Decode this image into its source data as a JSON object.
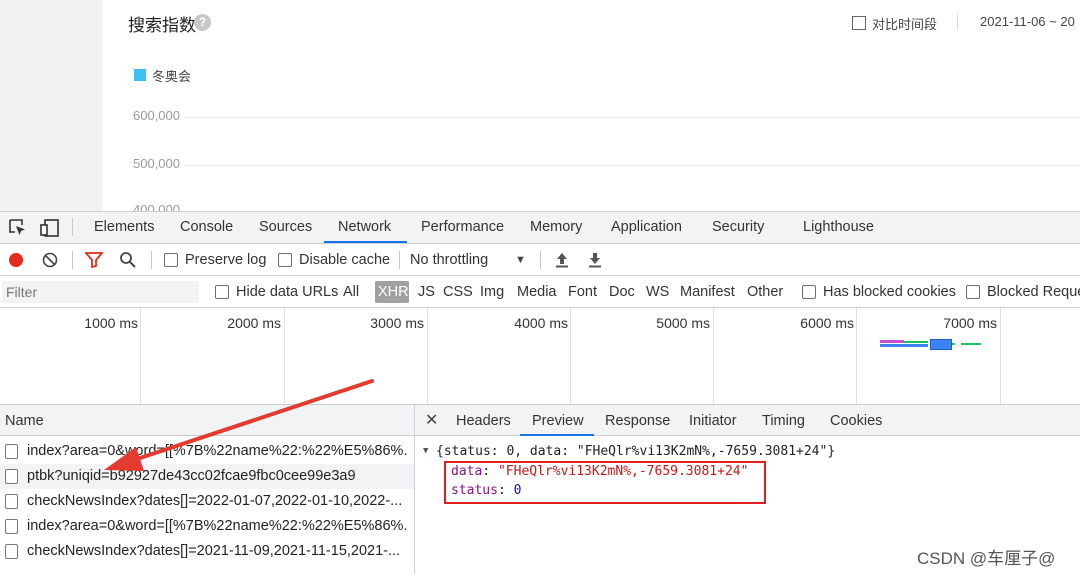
{
  "chart": {
    "title": "搜索指数",
    "help_icon": "?",
    "compare_label": "对比时间段",
    "date_range": "2021-11-06 ~ 20",
    "legend": "冬奥会",
    "legend_color": "#3ec1f0",
    "yticks": [
      "600,000",
      "500,000",
      "400,000"
    ]
  },
  "devtools": {
    "tabs": [
      "Elements",
      "Console",
      "Sources",
      "Network",
      "Performance",
      "Memory",
      "Application",
      "Security",
      "Lighthouse"
    ],
    "active_tab": "Network",
    "accent_color": "#1a73e8",
    "toolbar": {
      "preserve_log": "Preserve log",
      "disable_cache": "Disable cache",
      "throttling": "No throttling"
    },
    "filter": {
      "placeholder": "Filter",
      "hide_data_urls": "Hide data URLs",
      "types": [
        "All",
        "XHR",
        "JS",
        "CSS",
        "Img",
        "Media",
        "Font",
        "Doc",
        "WS",
        "Manifest",
        "Other"
      ],
      "active_type": "XHR",
      "has_blocked_cookies": "Has blocked cookies",
      "blocked_requests": "Blocked Reque"
    },
    "timeline": {
      "labels": [
        "1000 ms",
        "2000 ms",
        "3000 ms",
        "4000 ms",
        "5000 ms",
        "6000 ms",
        "7000 ms"
      ]
    },
    "requests": {
      "header": "Name",
      "rows": [
        "index?area=0&word=[[%7B%22name%22:%22%E5%86%...",
        "ptbk?uniqid=b92927de43cc02fcae9fbc0cee99e3a9",
        "checkNewsIndex?dates[]=2022-01-07,2022-01-10,2022-...",
        "index?area=0&word=[[%7B%22name%22:%22%E5%86%...",
        "checkNewsIndex?dates[]=2021-11-09,2021-11-15,2021-..."
      ],
      "selected_index": 1
    },
    "detail": {
      "tabs": [
        "Headers",
        "Preview",
        "Response",
        "Initiator",
        "Timing",
        "Cookies"
      ],
      "active_tab": "Preview",
      "summary": "{status: 0, data: \"FHeQlr%vi13K2mN%,-7659.3081+24\"}",
      "data_key": "data",
      "data_value": "\"FHeQlr%vi13K2mN%,-7659.3081+24\"",
      "status_key": "status",
      "status_value": "0",
      "highlight_color": "#e02020"
    }
  },
  "watermark": "CSDN @车厘子@"
}
